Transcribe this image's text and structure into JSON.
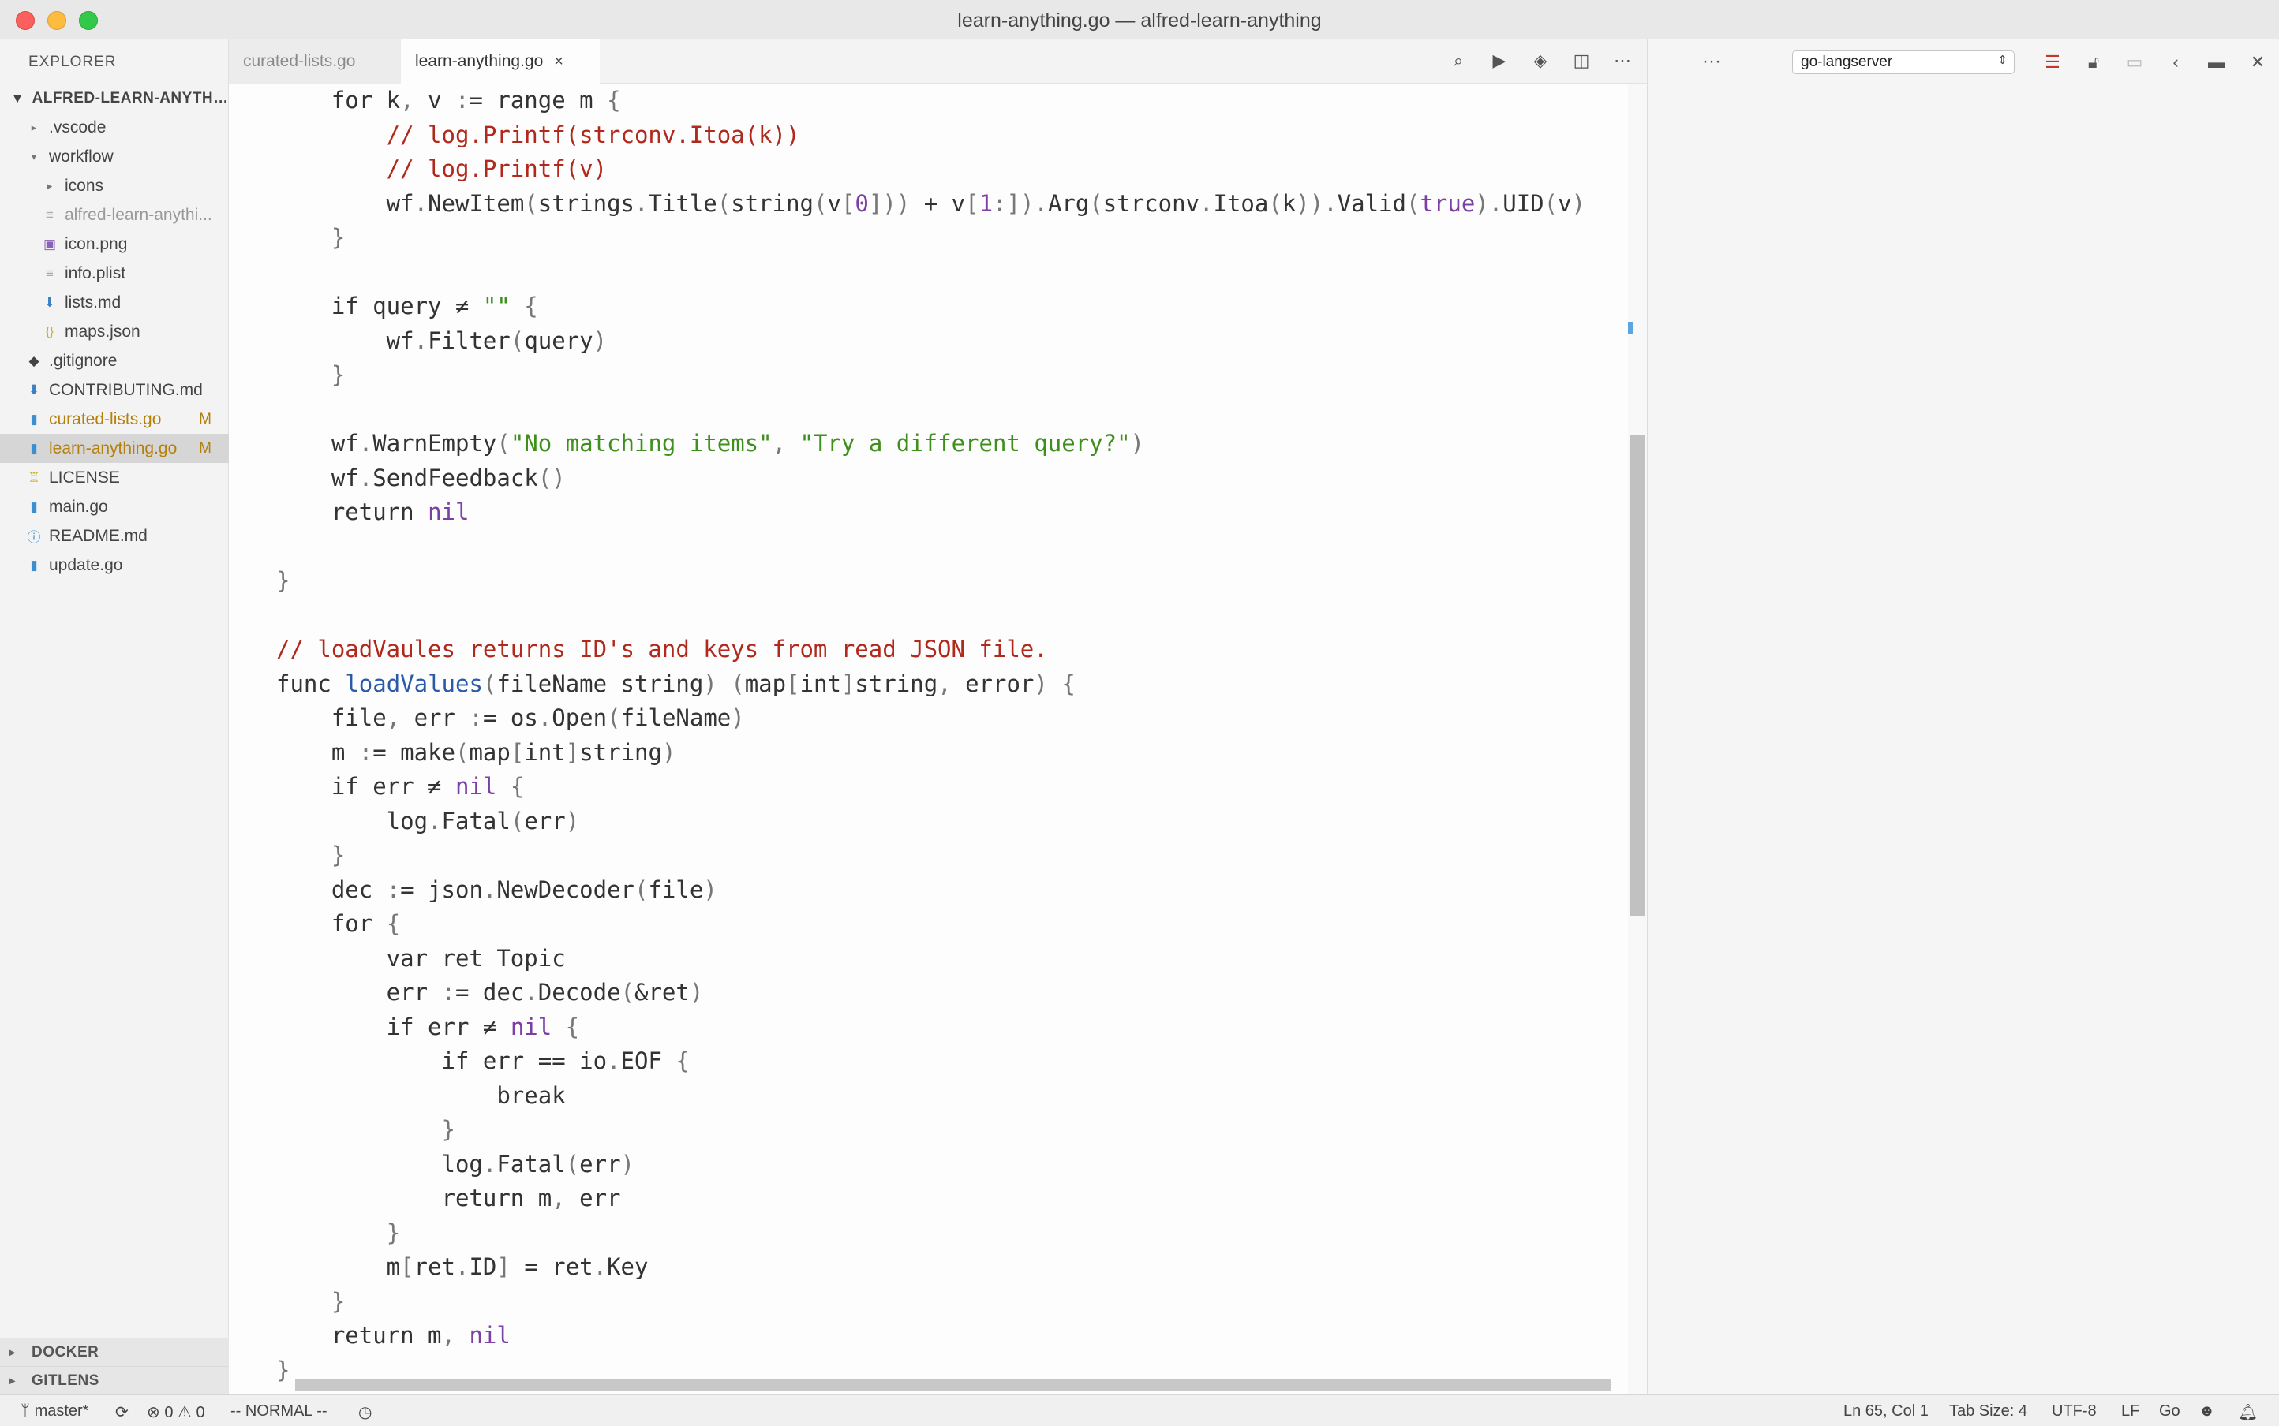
{
  "window": {
    "title": "learn-anything.go — alfred-learn-anything"
  },
  "sidebar": {
    "title": "EXPLORER",
    "root": "ALFRED-LEARN-ANYTHIN...",
    "items": [
      {
        "label": ".vscode",
        "badge": ""
      },
      {
        "label": "workflow",
        "badge": ""
      },
      {
        "label": "icons",
        "badge": ""
      },
      {
        "label": "alfred-learn-anythi...",
        "badge": ""
      },
      {
        "label": "icon.png",
        "badge": ""
      },
      {
        "label": "info.plist",
        "badge": ""
      },
      {
        "label": "lists.md",
        "badge": ""
      },
      {
        "label": "maps.json",
        "badge": ""
      },
      {
        "label": ".gitignore",
        "badge": ""
      },
      {
        "label": "CONTRIBUTING.md",
        "badge": ""
      },
      {
        "label": "curated-lists.go",
        "badge": "M"
      },
      {
        "label": "learn-anything.go",
        "badge": "M"
      },
      {
        "label": "LICENSE",
        "badge": ""
      },
      {
        "label": "main.go",
        "badge": ""
      },
      {
        "label": "README.md",
        "badge": ""
      },
      {
        "label": "update.go",
        "badge": ""
      }
    ],
    "sections": [
      "DOCKER",
      "GITLENS"
    ]
  },
  "tabs": [
    {
      "label": "curated-lists.go",
      "active": false
    },
    {
      "label": "learn-anything.go",
      "active": true,
      "close": "×"
    }
  ],
  "editor_actions": [
    "search-preview",
    "run",
    "git-compare",
    "split-editor",
    "more"
  ],
  "code_lines": [
    "    for k, v := range m {",
    "        // log.Printf(strconv.Itoa(k))",
    "        // log.Printf(v)",
    "        wf.NewItem(strings.Title(string(v[0])) + v[1:]).Arg(strconv.Itoa(k)).Valid(true).UID(v)",
    "    }",
    "",
    "    if query ≠ \"\" {",
    "        wf.Filter(query)",
    "    }",
    "",
    "    wf.WarnEmpty(\"No matching items\", \"Try a different query?\")",
    "    wf.SendFeedback()",
    "    return nil",
    "",
    "}",
    "",
    "// loadVaules returns ID's and keys from read JSON file.",
    "func loadValues(fileName string) (map[int]string, error) {",
    "    file, err := os.Open(fileName)",
    "    m := make(map[int]string)",
    "    if err ≠ nil {",
    "        log.Fatal(err)",
    "    }",
    "    dec := json.NewDecoder(file)",
    "    for {",
    "        var ret Topic",
    "        err := dec.Decode(&ret)",
    "        if err ≠ nil {",
    "            if err == io.EOF {",
    "                break",
    "            }",
    "            log.Fatal(err)",
    "            return m, err",
    "        }",
    "        m[ret.ID] = ret.Key",
    "    }",
    "    return m, nil",
    "}"
  ],
  "right_panel": {
    "dots": "···",
    "select_value": "go-langserver"
  },
  "statusbar": {
    "branch": "master*",
    "errors": "0",
    "warnings": "0",
    "mode": "-- NORMAL --",
    "position": "Ln 65, Col 1",
    "tab_size": "Tab Size: 4",
    "encoding": "UTF-8",
    "eol": "LF",
    "language": "Go"
  },
  "colors": {
    "comment": "#b0291c",
    "string": "#3e8f1b",
    "constant": "#7c3fa3",
    "function_name": "#2a5aa8",
    "modified": "#b5800a"
  }
}
